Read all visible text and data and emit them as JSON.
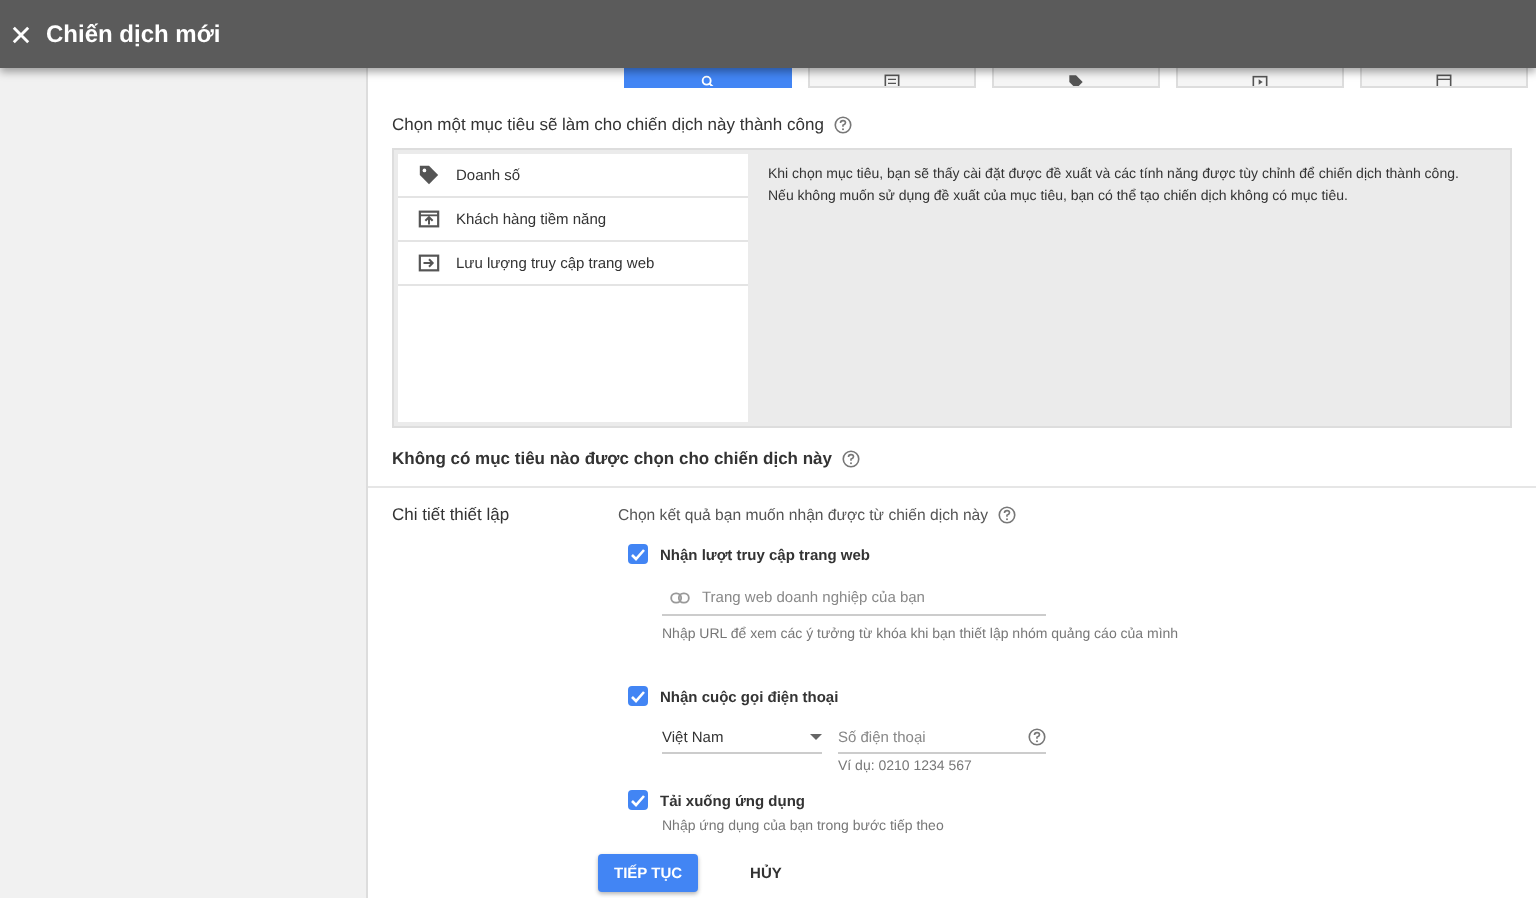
{
  "header": {
    "title": "Chiến dịch mới"
  },
  "campaign_types": [
    {
      "kind": "search",
      "selected": true
    },
    {
      "kind": "display",
      "selected": false
    },
    {
      "kind": "shopping",
      "selected": false
    },
    {
      "kind": "video",
      "selected": false
    },
    {
      "kind": "app",
      "selected": false
    }
  ],
  "goal_prompt": "Chọn một mục tiêu sẽ làm cho chiến dịch này thành công",
  "goals": [
    {
      "kind": "sales",
      "label": "Doanh số",
      "selected": false
    },
    {
      "kind": "leads",
      "label": "Khách hàng tiềm năng",
      "selected": false
    },
    {
      "kind": "traffic",
      "label": "Lưu lượng truy cập trang web",
      "selected": false
    }
  ],
  "goal_description": "Khi chọn mục tiêu, bạn sẽ thấy cài đặt được đề xuất và các tính năng được tùy chỉnh để chiến dịch thành công. Nếu không muốn sử dụng đề xuất của mục tiêu, bạn có thể tạo chiến dịch không có mục tiêu.",
  "no_goal_text": "Không có mục tiêu nào được chọn cho chiến dịch này",
  "settings": {
    "label": "Chi tiết thiết lập",
    "prompt": "Chọn kết quả bạn muốn nhận được từ chiến dịch này",
    "options": [
      {
        "kind": "website",
        "label": "Nhận lượt truy cập trang web",
        "checked": true,
        "placeholder": "Trang web doanh nghiệp của bạn",
        "hint": "Nhập URL để xem các ý tưởng từ khóa khi bạn thiết lập nhóm quảng cáo của mình"
      },
      {
        "kind": "phone",
        "label": "Nhận cuộc gọi điện thoại",
        "checked": true,
        "country": "Việt Nam",
        "placeholder": "Số điện thoại",
        "hint": "Ví dụ: 0210 1234 567"
      },
      {
        "kind": "app",
        "label": "Tải xuống ứng dụng",
        "checked": true,
        "hint": "Nhập ứng dụng của bạn trong bước tiếp theo"
      }
    ]
  },
  "buttons": {
    "primary": "TIẾP TỤC",
    "secondary": "HỦY"
  }
}
